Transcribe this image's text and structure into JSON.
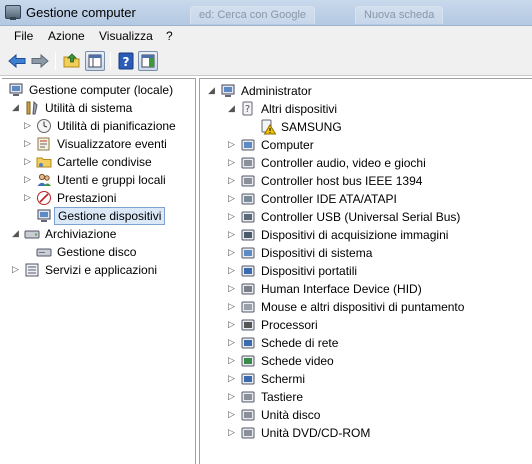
{
  "window": {
    "title": "Gestione computer",
    "ghost_tabs": [
      "ed: Cerca con Google",
      "Nuova scheda"
    ]
  },
  "menu": {
    "items": [
      "File",
      "Azione",
      "Visualizza",
      "?"
    ]
  },
  "left_tree": {
    "root": "Gestione computer (locale)",
    "utilita": "Utilità di sistema",
    "pianificazione": "Utilità di pianificazione",
    "eventi": "Visualizzatore eventi",
    "cartelle": "Cartelle condivise",
    "utenti": "Utenti e gruppi locali",
    "prestazioni": "Prestazioni",
    "dispositivi": "Gestione dispositivi",
    "archiviazione": "Archiviazione",
    "disco": "Gestione disco",
    "servizi": "Servizi e applicazioni"
  },
  "right_tree": {
    "root": "Administrator",
    "altri": "Altri dispositivi",
    "samsung": "SAMSUNG",
    "categories": [
      "Computer",
      "Controller audio, video e giochi",
      "Controller host bus IEEE 1394",
      "Controller IDE ATA/ATAPI",
      "Controller USB (Universal Serial Bus)",
      "Dispositivi di acquisizione immagini",
      "Dispositivi di sistema",
      "Dispositivi portatili",
      "Human Interface Device (HID)",
      "Mouse e altri dispositivi di puntamento",
      "Processori",
      "Schede di rete",
      "Schede video",
      "Schermi",
      "Tastiere",
      "Unità disco",
      "Unità DVD/CD-ROM"
    ]
  }
}
